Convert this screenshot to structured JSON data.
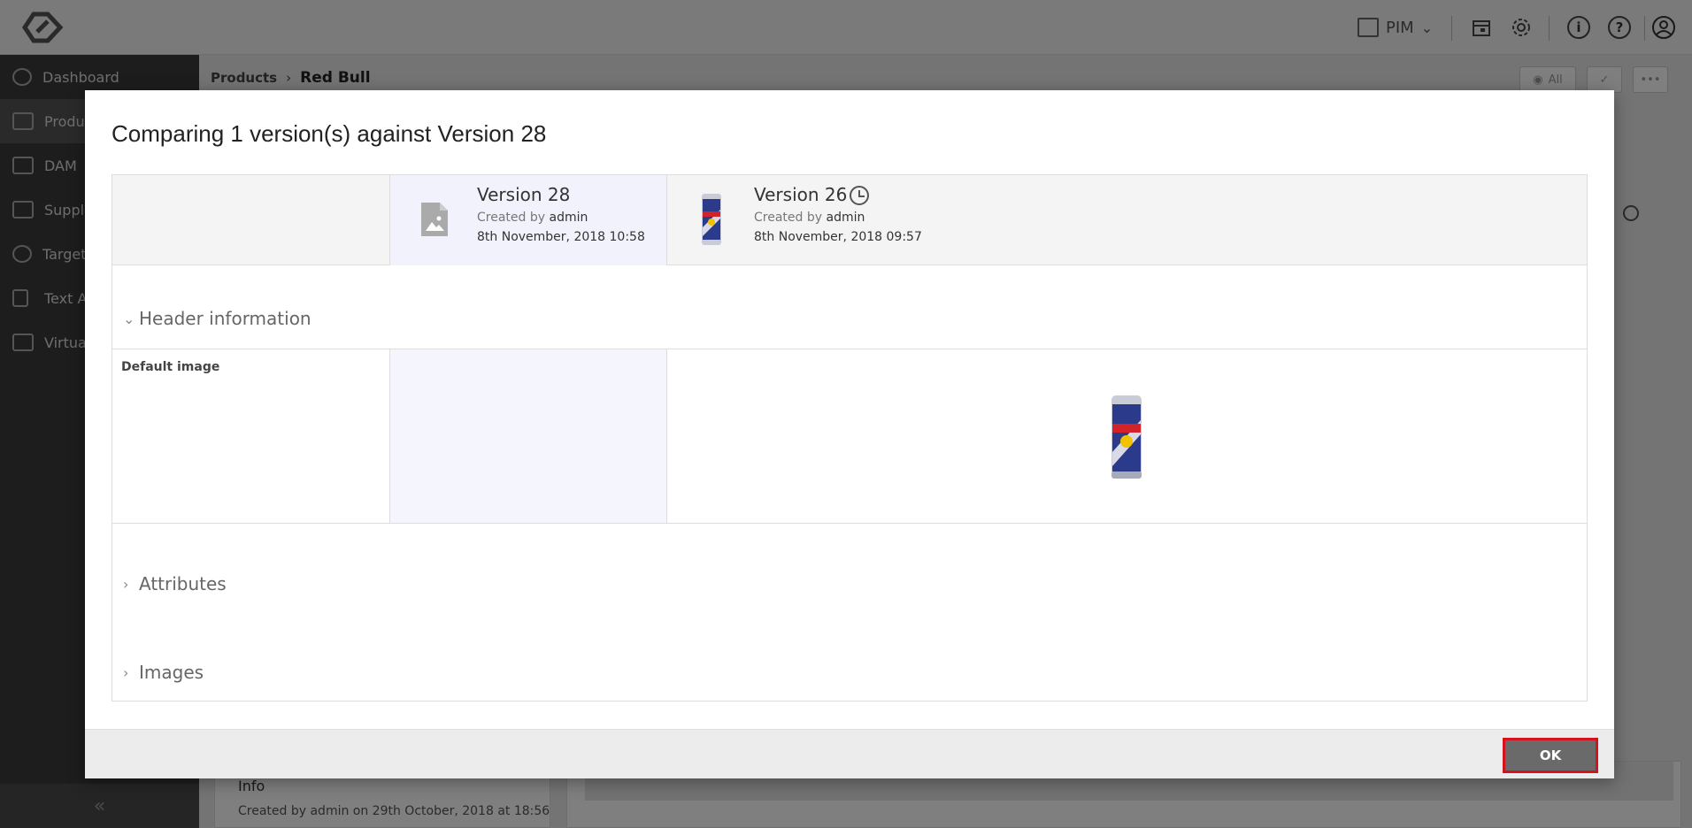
{
  "topbar": {
    "module_label": "PIM",
    "icons": [
      "logo-icon",
      "archive-icon",
      "calendar-icon",
      "gear-icon",
      "info-icon",
      "help-icon",
      "user-icon"
    ]
  },
  "sidebar": {
    "items": [
      {
        "label": "Dashboard",
        "icon": "dashboard-icon"
      },
      {
        "label": "Produ",
        "icon": "products-icon"
      },
      {
        "label": "DAM",
        "icon": "image-icon"
      },
      {
        "label": "Suppli",
        "icon": "truck-icon"
      },
      {
        "label": "Target",
        "icon": "target-icon"
      },
      {
        "label": "Text A",
        "icon": "document-icon"
      },
      {
        "label": "Virtua",
        "icon": "leaf-icon"
      }
    ],
    "collapse_glyph": "«"
  },
  "breadcrumb": {
    "parent": "Products",
    "separator": "›",
    "current": "Red Bull"
  },
  "toolbar": {
    "view_label": "All"
  },
  "bg_panel": {
    "title": "Info",
    "created_line": "Created by admin on 29th October, 2018 at 18:56"
  },
  "modal": {
    "title": "Comparing 1 version(s) against Version 28",
    "versions": [
      {
        "name": "Version 28",
        "created_by_label": "Created by",
        "created_by": "admin",
        "date": "8th November, 2018 10:58"
      },
      {
        "name": "Version 26",
        "created_by_label": "Created by",
        "created_by": "admin",
        "date": "8th November, 2018 09:57"
      }
    ],
    "sections": {
      "header": "Header information",
      "attributes": "Attributes",
      "images": "Images"
    },
    "rows": {
      "default_image_label": "Default image"
    },
    "ok_label": "OK"
  }
}
